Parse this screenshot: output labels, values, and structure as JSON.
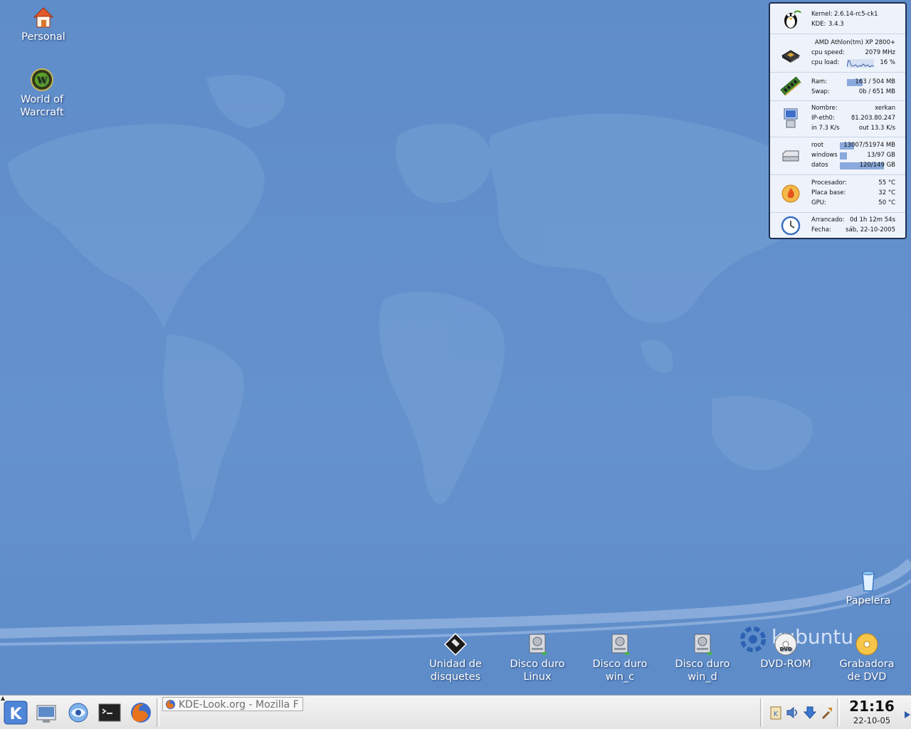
{
  "desktop": {
    "icons_top": [
      {
        "label": "Personal",
        "icon": "home-icon"
      },
      {
        "label": "World of\nWarcraft",
        "line1": "World of",
        "line2": "Warcraft",
        "icon": "warcraft-icon"
      }
    ],
    "trash": {
      "label": "Papelera",
      "icon": "trash-icon"
    },
    "devices": [
      {
        "line1": "Unidad de",
        "line2": "disquetes",
        "icon": "floppy-icon"
      },
      {
        "line1": "Disco duro",
        "line2": "Linux",
        "icon": "hard-drive-icon"
      },
      {
        "line1": "Disco duro",
        "line2": "win_c",
        "icon": "hard-drive-icon"
      },
      {
        "line1": "Disco duro",
        "line2": "win_d",
        "icon": "hard-drive-icon"
      },
      {
        "line1": "DVD-ROM",
        "line2": "",
        "icon": "dvd-icon"
      },
      {
        "line1": "Grabadora",
        "line2": "de DVD",
        "icon": "dvd-burner-icon"
      }
    ],
    "logo_text": "kubuntu"
  },
  "monitor": {
    "kernel": {
      "label": "Kernel:",
      "value": "2.6.14-rc5-ck1"
    },
    "kde": {
      "label": "KDE:",
      "value": "3.4.3"
    },
    "cpu": {
      "model": "AMD Athlon(tm) XP 2800+",
      "speed_label": "cpu speed:",
      "speed_value": "2079 MHz",
      "load_label": "cpu load:",
      "load_value": "16 %"
    },
    "memory": {
      "ram_label": "Ram:",
      "ram_value": "163 / 504 MB",
      "ram_fraction": 0.32,
      "swap_label": "Swap:",
      "swap_value": "0b / 651 MB",
      "swap_fraction": 0.0
    },
    "network": {
      "name_label": "Nombre:",
      "name_value": "xerkan",
      "ip_label": "IP-eth0:",
      "ip_value": "81.203.80.247",
      "in_value": "in 7.3 K/s",
      "out_value": "out 13.3 K/s"
    },
    "disks": [
      {
        "label": "root",
        "value": "13007/51974 MB",
        "fraction": 0.25
      },
      {
        "label": "windows",
        "value": "13/97 GB",
        "fraction": 0.13
      },
      {
        "label": "datos",
        "value": "120/149 GB",
        "fraction": 0.8
      }
    ],
    "temps": [
      {
        "label": "Procesador:",
        "value": "55  °C"
      },
      {
        "label": "Placa base:",
        "value": "32  °C"
      },
      {
        "label": "GPU:",
        "value": "50  °C"
      }
    ],
    "uptime": {
      "label": "Arrancado:",
      "value": "0d 1h 12m 54s"
    },
    "date": {
      "label": "Fecha:",
      "value": "sáb, 22-10-2005"
    }
  },
  "taskbar": {
    "launchers": [
      "kde-menu-icon",
      "desktop-icon",
      "konqueror-icon",
      "terminal-icon",
      "firefox-icon"
    ],
    "task": {
      "label": "KDE-Look.org - Mozilla F"
    },
    "tray": [
      "klipper-icon",
      "volume-icon",
      "update-icon",
      "kde-tools-icon"
    ],
    "clock": {
      "time": "21:16",
      "date": "22-10-05"
    }
  },
  "colors": {
    "desktop": "#6592cd",
    "accent": "#8aa9dc",
    "border": "#1d2f55"
  }
}
